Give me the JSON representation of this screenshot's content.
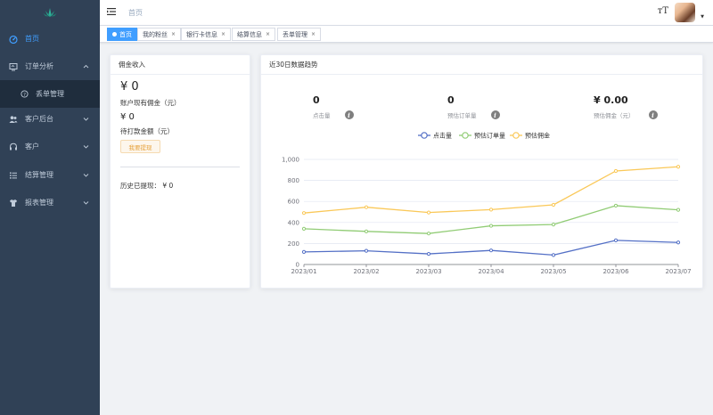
{
  "sidebar": {
    "items": [
      {
        "label": "首页",
        "icon": "dashboard-icon",
        "active": true
      },
      {
        "label": "订单分析",
        "icon": "order-analysis-icon",
        "expandable": true
      },
      {
        "label": "丢单管理",
        "icon": "question-circle-icon",
        "sub": true
      },
      {
        "label": "客户后台",
        "icon": "users-icon",
        "expandable": true
      },
      {
        "label": "客户",
        "icon": "headset-icon",
        "expandable": true
      },
      {
        "label": "结算管理",
        "icon": "list-icon",
        "expandable": true
      },
      {
        "label": "报表管理",
        "icon": "shirt-icon",
        "expandable": true
      }
    ]
  },
  "header": {
    "breadcrumb": "首页",
    "font_size_icon": "тT"
  },
  "tags": [
    "首页",
    "我的粉丝",
    "银行卡信息",
    "结算信息",
    "丢单管理"
  ],
  "commission": {
    "title": "佣金收入",
    "balance": "¥ 0",
    "balance_label": "账户现有佣金（元）",
    "pending": "¥ 0",
    "pending_label": "待打款金额（元）",
    "withdraw_button": "我要提现",
    "history": "历史已提现：  ¥ 0"
  },
  "trend": {
    "title": "近30日数据趋势",
    "stats": [
      {
        "value": "0",
        "label": "点击量"
      },
      {
        "value": "0",
        "label": "预估订单量"
      },
      {
        "value": "¥ 0.00",
        "label": "预估佣金（元）"
      }
    ]
  },
  "colors": {
    "sidebar_bg": "#304156",
    "accent": "#409eff",
    "series_clicks": "#5470c6",
    "series_orders": "#91cc75",
    "series_commission": "#fac858"
  },
  "chart_data": {
    "type": "line",
    "x": [
      "2023/01",
      "2023/02",
      "2023/03",
      "2023/04",
      "2023/05",
      "2023/06",
      "2023/07"
    ],
    "series": [
      {
        "name": "点击量",
        "values": [
          120,
          130,
          101,
          134,
          90,
          230,
          210
        ]
      },
      {
        "name": "预估订单量",
        "values": [
          340,
          315,
          295,
          368,
          380,
          560,
          520
        ]
      },
      {
        "name": "预估佣金",
        "values": [
          490,
          545,
          495,
          522,
          568,
          890,
          930
        ]
      }
    ],
    "ylim": [
      0,
      1000
    ],
    "yticks": [
      "0",
      "200",
      "400",
      "600",
      "800",
      "1,000"
    ],
    "legend": "top-center",
    "grid": true
  }
}
